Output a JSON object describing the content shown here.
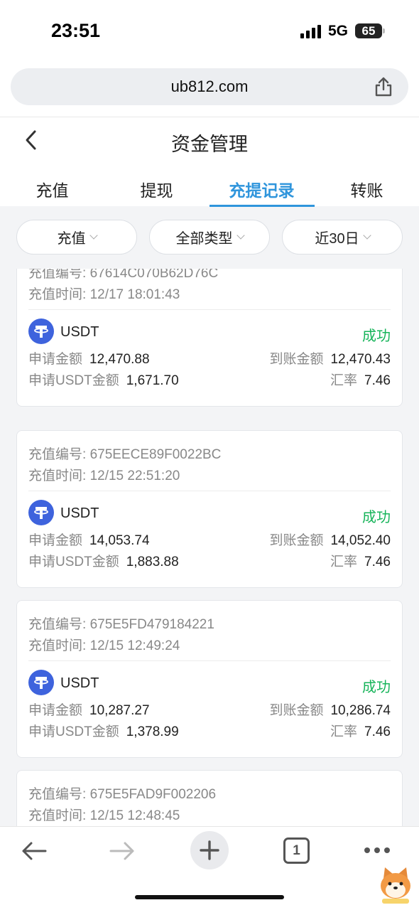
{
  "status_bar": {
    "time": "23:51",
    "network": "5G",
    "battery": "65"
  },
  "browser": {
    "url": "ub812.com"
  },
  "header": {
    "title": "资金管理"
  },
  "tabs": [
    {
      "label": "充值",
      "active": false
    },
    {
      "label": "提现",
      "active": false
    },
    {
      "label": "充提记录",
      "active": true
    },
    {
      "label": "转账",
      "active": false
    }
  ],
  "filters": {
    "type": "充值",
    "category": "全部类型",
    "range": "近30日"
  },
  "labels": {
    "order_prefix": "充值编号: ",
    "time_prefix": "充值时间: ",
    "apply_amount": "申请金额",
    "received_amount": "到账金额",
    "apply_usdt_amount": "申请USDT金额",
    "rate": "汇率"
  },
  "records": [
    {
      "order_no": "67614C070B62D76C",
      "time": "12/17 18:01:43",
      "coin": "USDT",
      "status": "成功",
      "apply_amount": "12,470.88",
      "received_amount": "12,470.43",
      "usdt_amount": "1,671.70",
      "rate": "7.46"
    },
    {
      "order_no": "675EECE89F0022BC",
      "time": "12/15 22:51:20",
      "coin": "USDT",
      "status": "成功",
      "apply_amount": "14,053.74",
      "received_amount": "14,052.40",
      "usdt_amount": "1,883.88",
      "rate": "7.46"
    },
    {
      "order_no": "675E5FD479184221",
      "time": "12/15 12:49:24",
      "coin": "USDT",
      "status": "成功",
      "apply_amount": "10,287.27",
      "received_amount": "10,286.74",
      "usdt_amount": "1,378.99",
      "rate": "7.46"
    },
    {
      "order_no": "675E5FAD9F002206",
      "time": "12/15 12:48:45"
    }
  ],
  "toolbar": {
    "tab_count": "1"
  },
  "colors": {
    "accent": "#2f95dc",
    "success": "#17b45a",
    "usdt": "#3e63dd"
  }
}
